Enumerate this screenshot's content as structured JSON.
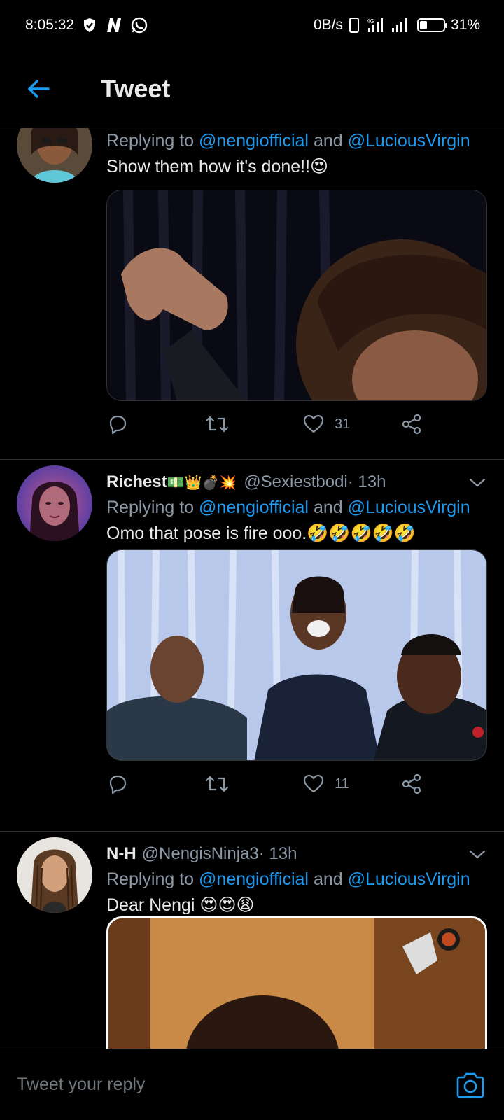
{
  "status_bar": {
    "time": "8:05:32",
    "net_speed": "0B/s",
    "battery": "31%",
    "battery_level": 0.31
  },
  "header": {
    "title": "Tweet"
  },
  "tweets": [
    {
      "replying_prefix": "Replying to ",
      "mention1": "@nengiofficial",
      "and": " and ",
      "mention2": "@LuciousVirgin",
      "text": "Show them how it's done!!",
      "text_emoji": "😍",
      "like_count": "31"
    },
    {
      "name": "Richest",
      "name_emoji": "💵👑💣💥",
      "handle": "@Sexiestbodi",
      "time": " · 13h",
      "replying_prefix": "Replying to ",
      "mention1": "@nengiofficial",
      "and": " and ",
      "mention2": "@LuciousVirgin",
      "text": "Omo that pose is fire ooo.",
      "text_emoji": "🤣🤣🤣🤣🤣",
      "like_count": "11"
    },
    {
      "name": "N-H",
      "handle": "@NengisNinja3",
      "time": " · 13h",
      "replying_prefix": "Replying to ",
      "mention1": "@nengiofficial",
      "and": " and ",
      "mention2": "@LuciousVirgin",
      "text": "Dear Nengi ",
      "text_emoji": "😍😍😩"
    }
  ],
  "reply_bar": {
    "placeholder": "Tweet your reply"
  },
  "colors": {
    "accent": "#1d9bf0",
    "background": "#000000",
    "muted": "#8b98a5"
  }
}
